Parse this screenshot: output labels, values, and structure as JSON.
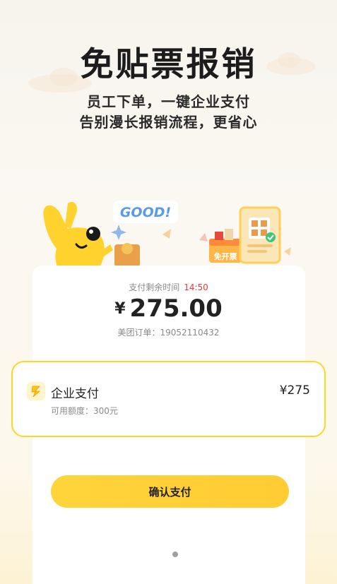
{
  "header": {
    "title": "免贴票报销",
    "subtitle_line1": "员工下单，一键企业支付",
    "subtitle_line2": "告别漫长报销流程，更省心"
  },
  "illustration": {
    "bubble_text": "GOOD!",
    "box_label": "免开票"
  },
  "order": {
    "timer_label": "支付剩余时间",
    "timer_value": "14:50",
    "currency": "¥",
    "amount": "275.00",
    "order_no": "美团订单：19052110432"
  },
  "payment_option": {
    "icon": "enterprise-pay-icon",
    "title": "企业支付",
    "amount": "¥275",
    "quota": "可用额度：300元"
  },
  "confirm_label": "确认支付",
  "colors": {
    "accent": "#ffd43b",
    "timer": "#e23b3b",
    "text": "#222222",
    "muted": "#8a8a8a"
  }
}
